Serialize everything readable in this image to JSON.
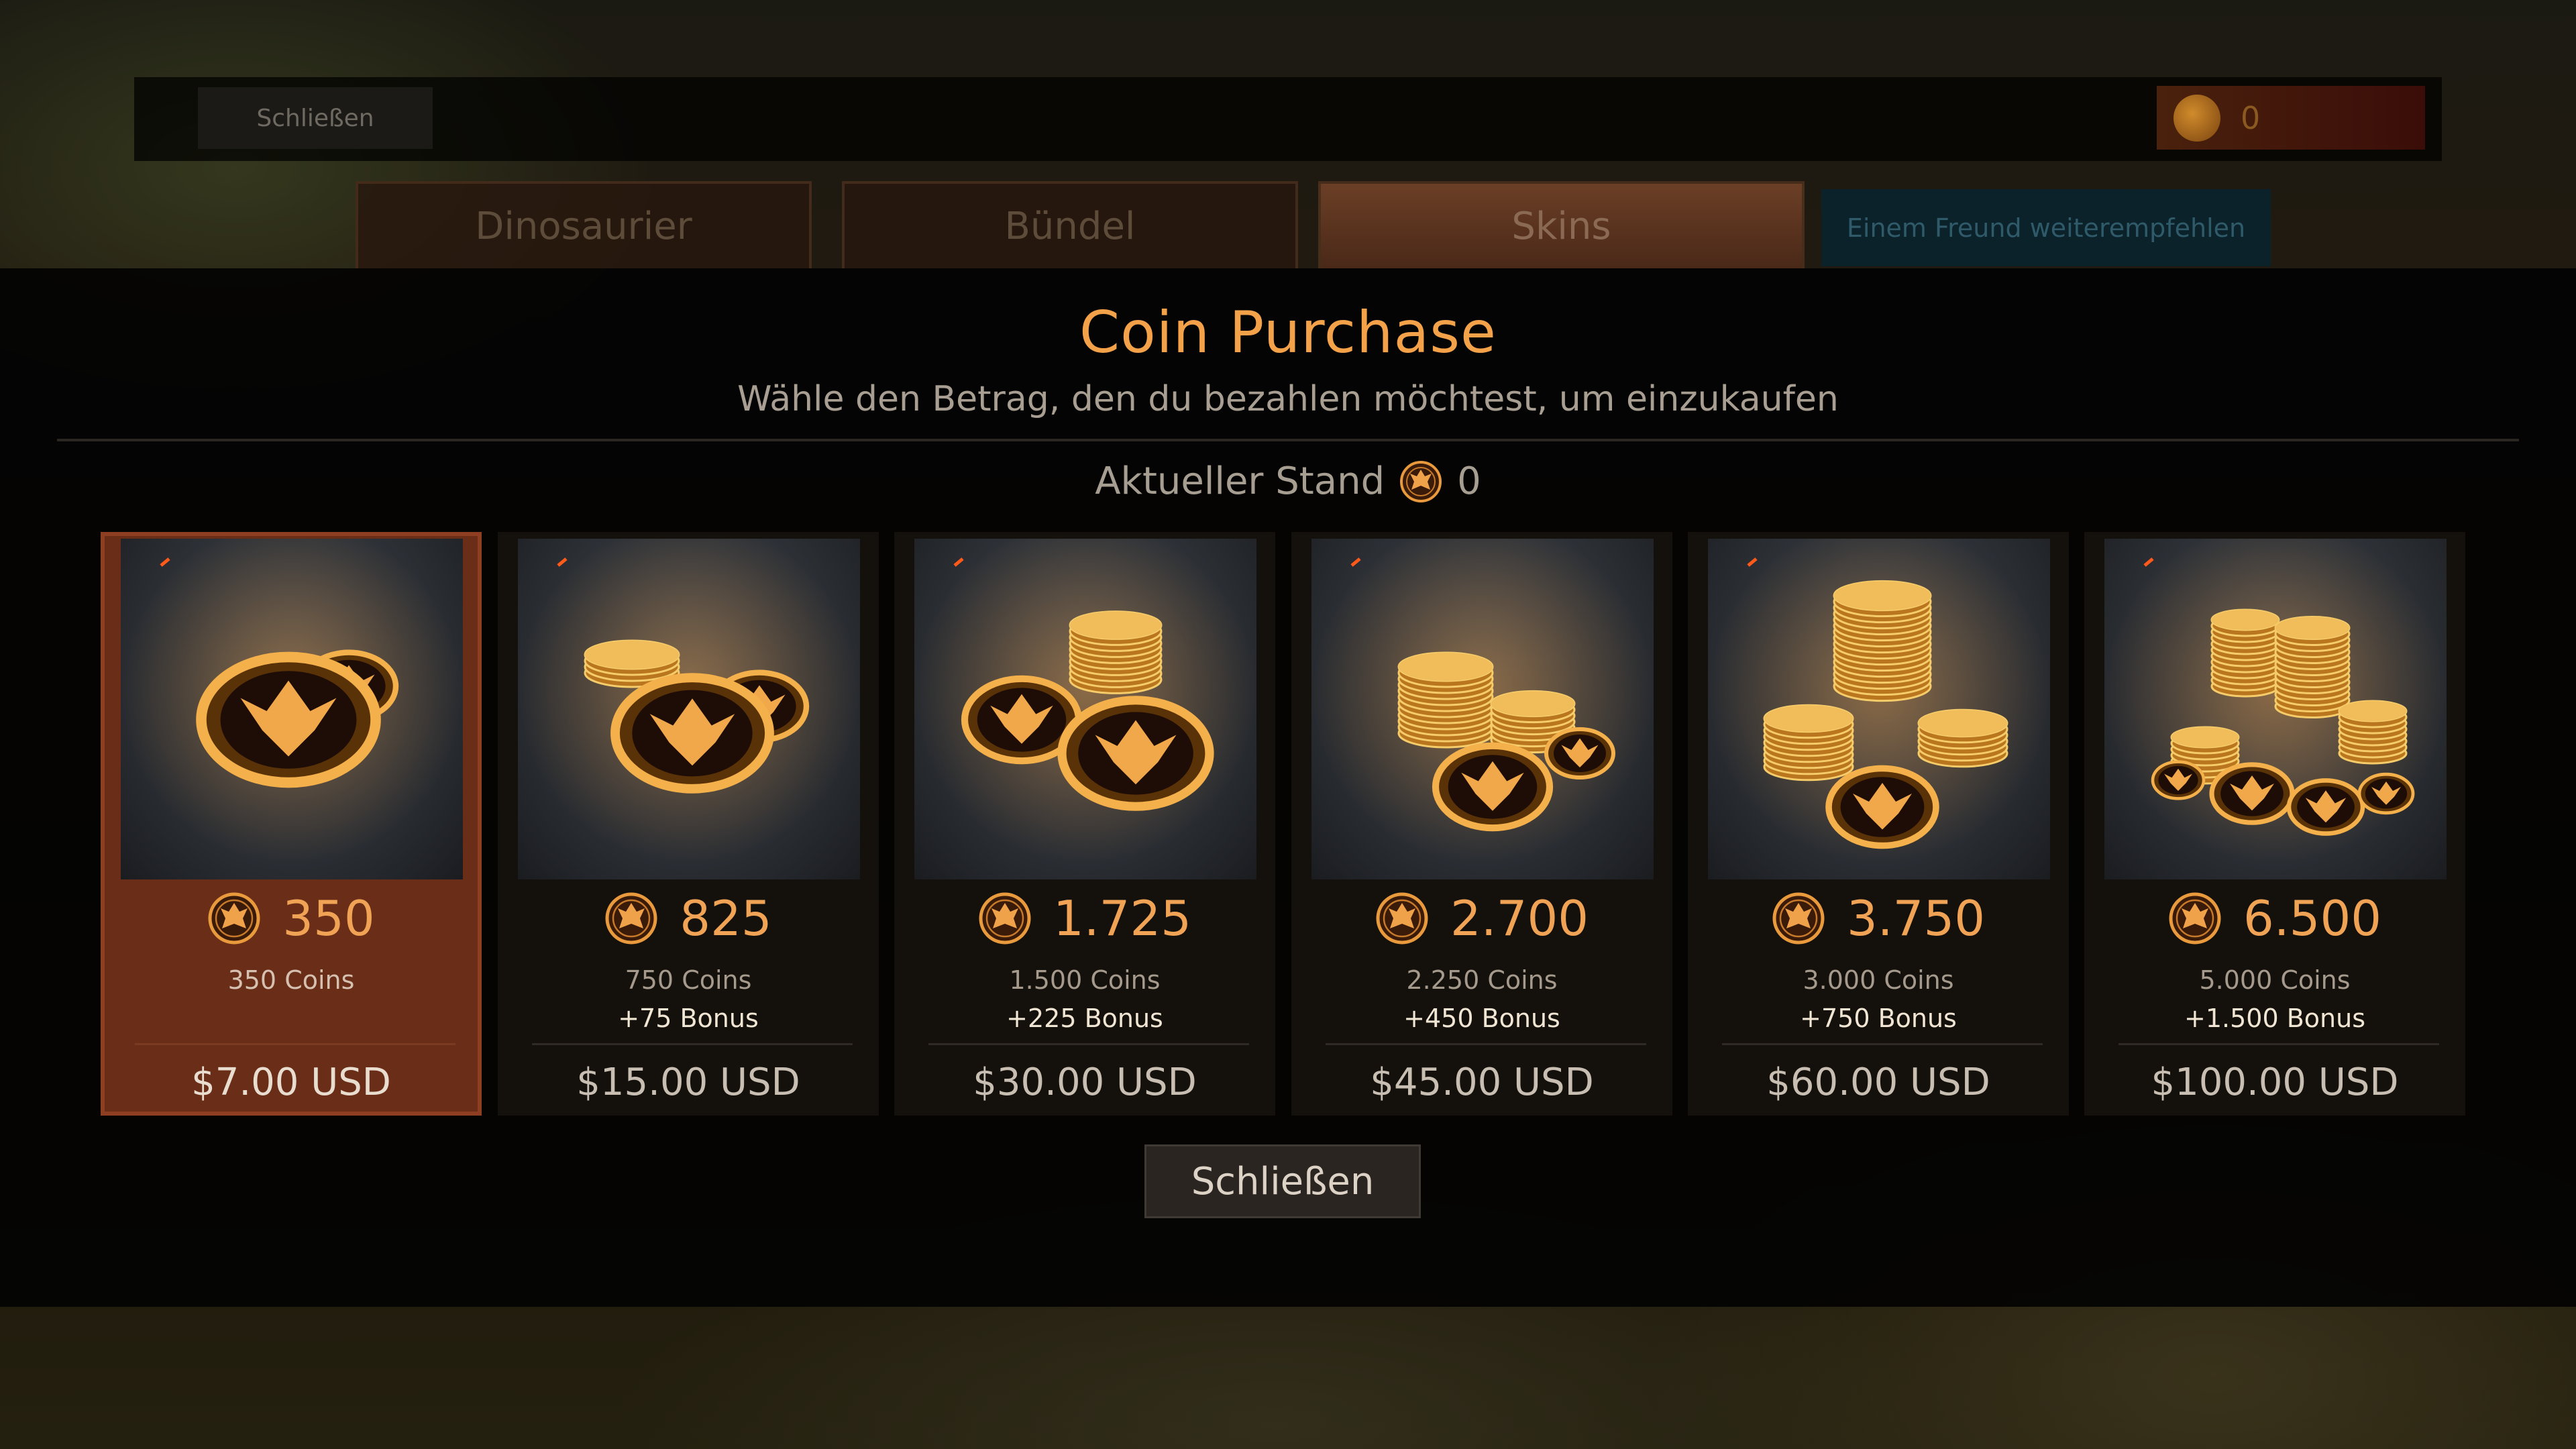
{
  "background": {
    "close_label": "Schließen",
    "wallet_value": "0",
    "tabs": [
      "Dinosaurier",
      "Bündel",
      "Skins"
    ],
    "refer_label": "Einem Freund weiterempfehlen"
  },
  "modal": {
    "title": "Coin Purchase",
    "subtitle": "Wähle den Betrag, den du bezahlen möchtest, um einzukaufen",
    "balance_label": "Aktueller Stand",
    "balance_value": "0",
    "close_label": "Schließen"
  },
  "packages": [
    {
      "amount": "350",
      "coins": "350 Coins",
      "bonus": "",
      "price": "$7.00 USD",
      "selected": true
    },
    {
      "amount": "825",
      "coins": "750 Coins",
      "bonus": "+75 Bonus",
      "price": "$15.00 USD",
      "selected": false
    },
    {
      "amount": "1.725",
      "coins": "1.500 Coins",
      "bonus": "+225 Bonus",
      "price": "$30.00 USD",
      "selected": false
    },
    {
      "amount": "2.700",
      "coins": "2.250 Coins",
      "bonus": "+450 Bonus",
      "price": "$45.00 USD",
      "selected": false
    },
    {
      "amount": "3.750",
      "coins": "3.000 Coins",
      "bonus": "+750 Bonus",
      "price": "$60.00 USD",
      "selected": false
    },
    {
      "amount": "6.500",
      "coins": "5.000 Coins",
      "bonus": "+1.500 Bonus",
      "price": "$100.00 USD",
      "selected": false
    }
  ],
  "icons": {
    "coin": "coin-icon"
  },
  "colors": {
    "accent": "#f4a24a",
    "selected_card": "#6a2e18",
    "modal_bg": "#030303"
  }
}
